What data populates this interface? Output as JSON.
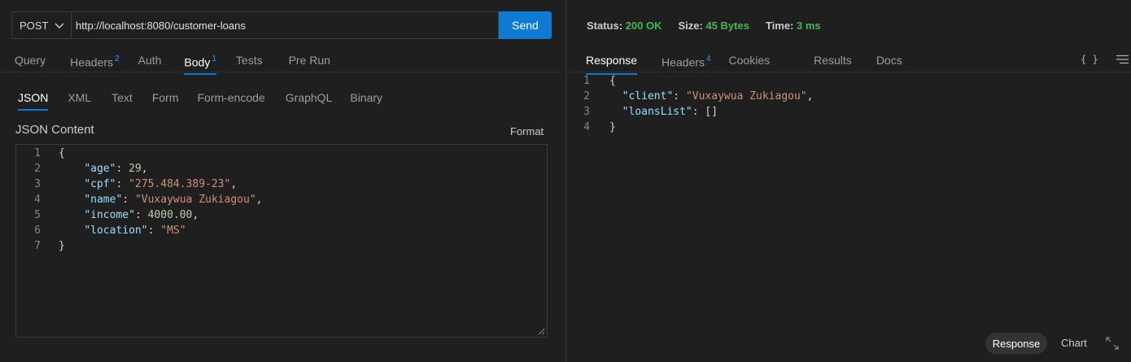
{
  "request": {
    "method": "POST",
    "url": "http://localhost:8080/customer-loans",
    "send_label": "Send"
  },
  "request_tabs": [
    {
      "label": "Query",
      "badge": ""
    },
    {
      "label": "Headers",
      "badge": "2"
    },
    {
      "label": "Auth",
      "badge": ""
    },
    {
      "label": "Body",
      "badge": "1",
      "active": true
    },
    {
      "label": "Tests",
      "badge": ""
    },
    {
      "label": "Pre Run",
      "badge": ""
    }
  ],
  "body_tabs": [
    "JSON",
    "XML",
    "Text",
    "Form",
    "Form-encode",
    "GraphQL",
    "Binary"
  ],
  "body_tab_active": "JSON",
  "content_title": "JSON Content",
  "format_label": "Format",
  "request_code": [
    {
      "num": "1",
      "text": "{"
    },
    {
      "num": "2",
      "text": "    \"age\": 29,"
    },
    {
      "num": "3",
      "text": "    \"cpf\": \"275.484.389-23\","
    },
    {
      "num": "4",
      "text": "    \"name\": \"Vuxaywua Zukiagou\","
    },
    {
      "num": "5",
      "text": "    \"income\": 4000.00,"
    },
    {
      "num": "6",
      "text": "    \"location\": \"MS\""
    },
    {
      "num": "7",
      "text": "}"
    }
  ],
  "status": {
    "status_label": "Status:",
    "status_value": "200 OK",
    "size_label": "Size:",
    "size_value": "45 Bytes",
    "time_label": "Time:",
    "time_value": "3 ms"
  },
  "response_tabs": [
    {
      "label": "Response",
      "badge": "",
      "active": true
    },
    {
      "label": "Headers",
      "badge": "4"
    },
    {
      "label": "Cookies",
      "badge": ""
    },
    {
      "label": "Results",
      "badge": ""
    },
    {
      "label": "Docs",
      "badge": ""
    }
  ],
  "response_tools": {
    "braces_icon": "{ }",
    "menu_icon": "menu-icon"
  },
  "response_code": [
    {
      "num": "1",
      "text": "{"
    },
    {
      "num": "2",
      "text": "  \"client\": \"Vuxaywua Zukiagou\","
    },
    {
      "num": "3",
      "text": "  \"loansList\": []"
    },
    {
      "num": "4",
      "text": "}"
    }
  ],
  "bottom": {
    "response_label": "Response",
    "chart_label": "Chart"
  },
  "colors": {
    "accent": "#0e7ad3",
    "success": "#3fb950",
    "key": "#9cdcfe",
    "string": "#ce9178",
    "number": "#b5cea8"
  }
}
